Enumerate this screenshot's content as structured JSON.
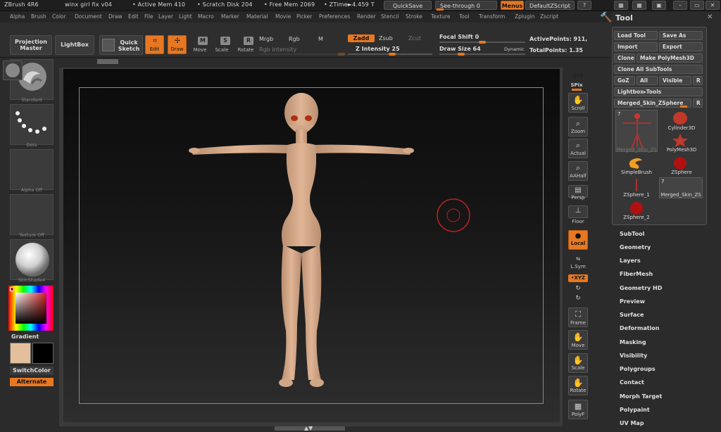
{
  "titlebar": {
    "app_version": "ZBrush 4R6",
    "doc_name": "winx girl fix v04",
    "active_mem": "• Active Mem 410",
    "scratch_disk": "• Scratch Disk 204",
    "free_mem": "• Free Mem 2069",
    "ztime": "• ZTime►4.459 T",
    "quicksave": "QuickSave",
    "see_through": "See-through  0",
    "menus": "Menus",
    "default_zscript": "DefaultZScript"
  },
  "menubar": {
    "items": [
      "Alpha",
      "Brush",
      "Color",
      "Document",
      "Draw",
      "Edit",
      "File",
      "Layer",
      "Light",
      "Macro",
      "Marker",
      "Material",
      "Movie",
      "Picker",
      "Preferences",
      "Render",
      "Stencil",
      "Stroke",
      "Texture",
      "Tool",
      "Transform",
      "Zplugin",
      "Zscript"
    ]
  },
  "toolbar": {
    "projection_master": "Projection Master",
    "lightbox": "LightBox",
    "quick_sketch": "Quick Sketch",
    "edit": "Edit",
    "draw": "Draw",
    "move": "Move",
    "scale": "Scale",
    "rotate": "Rotate",
    "mrgb": "Mrgb",
    "rgb": "Rgb",
    "m": "M",
    "rgb_intensity": "Rgb Intensity",
    "zadd": "Zadd",
    "zsub": "Zsub",
    "zcut": "Zcut",
    "z_intensity": "Z Intensity 25",
    "focal_shift": "Focal Shift 0",
    "draw_size": "Draw Size 64",
    "dynamic": "Dynamic",
    "active_points": "ActivePoints: 911,",
    "total_points": "TotalPoints: 1.35"
  },
  "leftpanel": {
    "standard": "Standard",
    "dots": "Dots",
    "alpha_off": "Alpha Off",
    "texture_off": "Texture Off",
    "skinshade": "SkinShade4",
    "gradient": "Gradient",
    "switch_color": "SwitchColor",
    "alternate": "Alternate",
    "main_color": "#e4bf9c",
    "secondary_color": "#000000"
  },
  "dock": {
    "bpr": "BPR",
    "spix": "SPix",
    "scroll": "Scroll",
    "zoom": "Zoom",
    "actual": "Actual",
    "aahalf": "AAHalf",
    "persp": "Persp",
    "floor": "Floor",
    "local": "Local",
    "lsym": "L.Sym",
    "xyz": "•XYZ",
    "frame": "Frame",
    "move": "Move",
    "scale": "Scale",
    "rotate": "Rotate",
    "polyf": "PolyF"
  },
  "toolpanel": {
    "title": "Tool",
    "load_tool": "Load Tool",
    "save_as": "Save As",
    "import": "Import",
    "export": "Export",
    "clone": "Clone",
    "make_polymesh": "Make PolyMesh3D",
    "clone_all": "Clone All SubTools",
    "goz": "GoZ",
    "all": "All",
    "visible": "Visible",
    "r": "R",
    "lightbox_tools": "Lightbox▸Tools",
    "current_tool": "Merged_Skin_ZSphere",
    "tools": [
      {
        "label": "Merged_Skin_ZS",
        "count": "7"
      },
      {
        "label": "Cylinder3D",
        "count": ""
      },
      {
        "label": "PolyMesh3D",
        "count": ""
      },
      {
        "label": "SimpleBrush",
        "count": ""
      },
      {
        "label": "ZSphere",
        "count": ""
      },
      {
        "label": "ZSphere_1",
        "count": ""
      },
      {
        "label": "Merged_Skin_ZS",
        "count": "7"
      },
      {
        "label": "ZSphere_2",
        "count": ""
      }
    ],
    "sections": [
      "SubTool",
      "Geometry",
      "Layers",
      "FiberMesh",
      "Geometry HD",
      "Preview",
      "Surface",
      "Deformation",
      "Masking",
      "Visibility",
      "Polygroups",
      "Contact",
      "Morph Target",
      "Polypaint",
      "UV Map"
    ]
  }
}
